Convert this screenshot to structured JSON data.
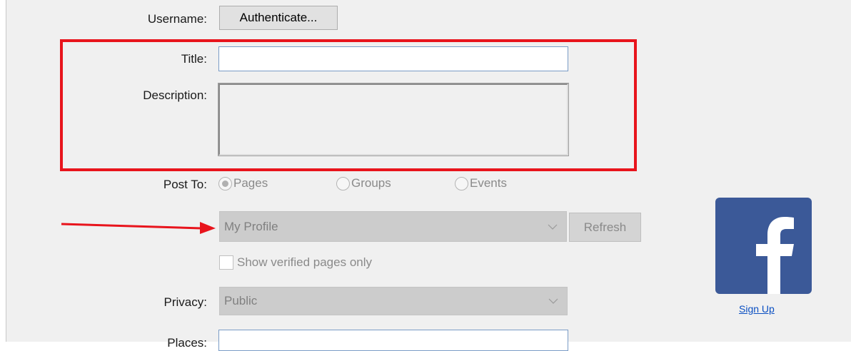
{
  "form": {
    "username_label": "Username:",
    "authenticate_button": "Authenticate...",
    "title_label": "Title:",
    "title_value": "",
    "description_label": "Description:",
    "description_value": "",
    "post_to_label": "Post To:",
    "post_to_options": [
      {
        "label": "Pages",
        "selected": true
      },
      {
        "label": "Groups",
        "selected": false
      },
      {
        "label": "Events",
        "selected": false
      }
    ],
    "target_select_value": "My Profile",
    "refresh_button": "Refresh",
    "verified_only_label": "Show verified pages only",
    "verified_only_checked": false,
    "privacy_label": "Privacy:",
    "privacy_value": "Public",
    "places_label": "Places:",
    "places_value": ""
  },
  "sidebar": {
    "logo_icon": "facebook-logo-icon",
    "signup_link": "Sign Up"
  },
  "annotations": {
    "highlight_color": "#e8141c",
    "arrow_color": "#e8141c"
  },
  "colors": {
    "facebook_blue": "#3b5998",
    "link_blue": "#0a4fc2"
  }
}
